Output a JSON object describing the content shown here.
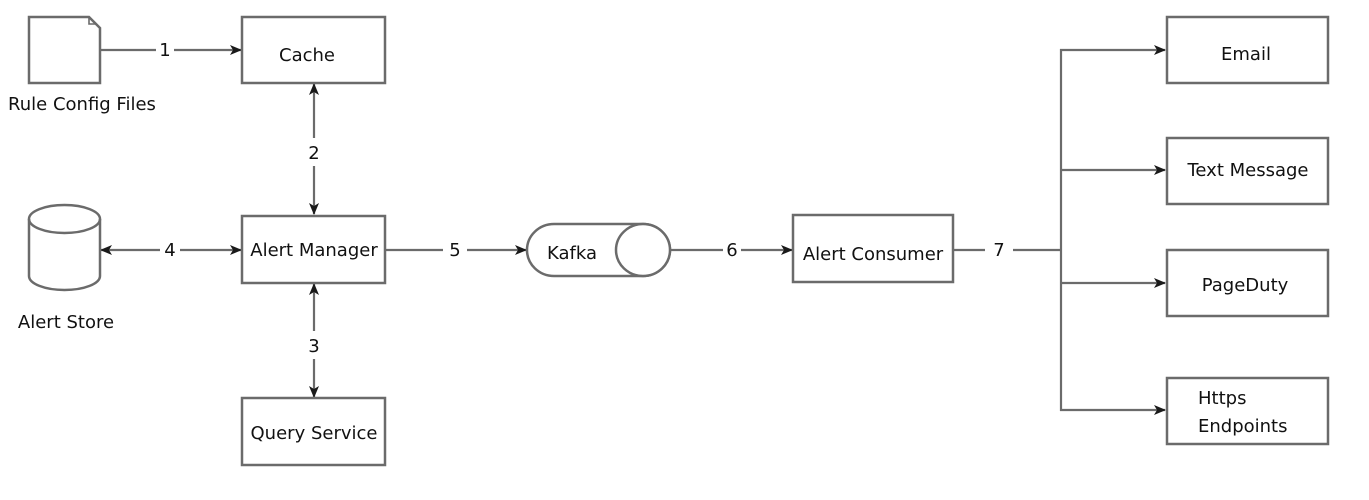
{
  "diagram": {
    "nodes": {
      "rule_config": {
        "label": "Rule Config Files",
        "shape": "document"
      },
      "cache": {
        "label": "Cache",
        "shape": "rectangle"
      },
      "alert_store": {
        "label": "Alert Store",
        "shape": "cylinder"
      },
      "alert_manager": {
        "label": "Alert Manager",
        "shape": "rectangle"
      },
      "query_service": {
        "label": "Query Service",
        "shape": "rectangle"
      },
      "kafka": {
        "label": "Kafka",
        "shape": "queue"
      },
      "alert_consumer": {
        "label": "Alert Consumer",
        "shape": "rectangle"
      },
      "email": {
        "label": "Email",
        "shape": "rectangle"
      },
      "text_message": {
        "label": "Text Message",
        "shape": "rectangle"
      },
      "pageduty": {
        "label": "PageDuty",
        "shape": "rectangle"
      },
      "https_endpoints": {
        "label_line1": "Https",
        "label_line2": "Endpoints",
        "shape": "rectangle"
      }
    },
    "edges": [
      {
        "id": "e1",
        "label": "1",
        "from": "Rule Config Files",
        "to": "Cache",
        "direction": "forward"
      },
      {
        "id": "e2",
        "label": "2",
        "from": "Cache",
        "to": "Alert Manager",
        "direction": "both"
      },
      {
        "id": "e3",
        "label": "3",
        "from": "Alert Manager",
        "to": "Query Service",
        "direction": "both"
      },
      {
        "id": "e4",
        "label": "4",
        "from": "Alert Store",
        "to": "Alert Manager",
        "direction": "both"
      },
      {
        "id": "e5",
        "label": "5",
        "from": "Alert Manager",
        "to": "Kafka",
        "direction": "forward"
      },
      {
        "id": "e6",
        "label": "6",
        "from": "Kafka",
        "to": "Alert Consumer",
        "direction": "forward"
      },
      {
        "id": "e7",
        "label": "7",
        "from": "Alert Consumer",
        "to": [
          "Email",
          "Text Message",
          "PageDuty",
          "Https Endpoints"
        ],
        "direction": "forward"
      }
    ],
    "colors": {
      "stroke": "#6b6b6b",
      "text": "#111111",
      "background": "#ffffff"
    }
  }
}
